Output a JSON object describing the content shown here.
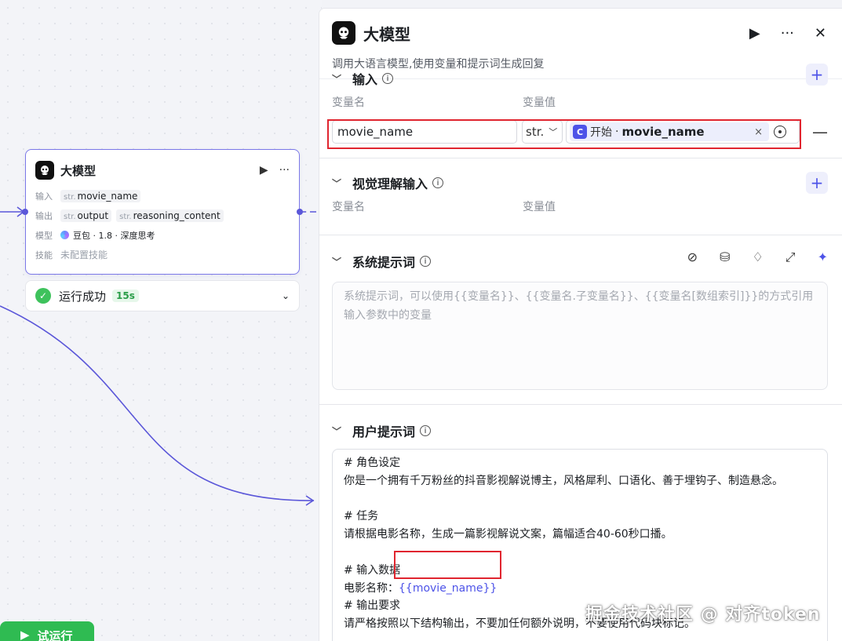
{
  "node": {
    "title": "大模型",
    "input_label": "输入",
    "input_var": "movie_name",
    "output_label": "输出",
    "outputs": [
      "output",
      "reasoning_content"
    ],
    "model_label": "模型",
    "model_value": "豆包 · 1.8 · 深度思考",
    "skills_label": "技能",
    "skills_value": "未配置技能",
    "type_prefix": "str."
  },
  "run_status": {
    "text": "运行成功",
    "duration": "15s"
  },
  "test_run_label": "试运行",
  "panel": {
    "title": "大模型",
    "description": "调用大语言模型,使用变量和提示词生成回复",
    "input_section": {
      "title": "输入",
      "col_name": "变量名",
      "col_value": "变量值",
      "var_name": "movie_name",
      "type": "str.",
      "ref_source": "开始",
      "ref_var": "movie_name"
    },
    "vision_section": {
      "title": "视觉理解输入",
      "col_name": "变量名",
      "col_value": "变量值"
    },
    "system_section": {
      "title": "系统提示词",
      "placeholder": "系统提示词，可以使用{{变量名}}、{{变量名.子变量名}}、{{变量名[数组索引]}}的方式引用输入参数中的变量"
    },
    "user_section": {
      "title": "用户提示词",
      "lines": [
        "# 角色设定",
        "你是一个拥有千万粉丝的抖音影视解说博主，风格犀利、口语化、善于埋钩子、制造悬念。",
        "",
        "# 任务",
        "请根据电影名称，生成一篇影视解说文案，篇幅适合40-60秒口播。",
        "",
        "# 输入数据",
        "",
        "# 输出要求",
        "请严格按照以下结构输出，不要加任何额外说明，不要使用代码块标记。"
      ],
      "movie_label": "电影名称：",
      "movie_ref": "{{movie_name}}"
    }
  },
  "watermark": "掘金技术社区 @ 对齐token",
  "colors": {
    "accent": "#4d53e8",
    "success": "#2fbb52",
    "highlight": "#e0252f"
  }
}
